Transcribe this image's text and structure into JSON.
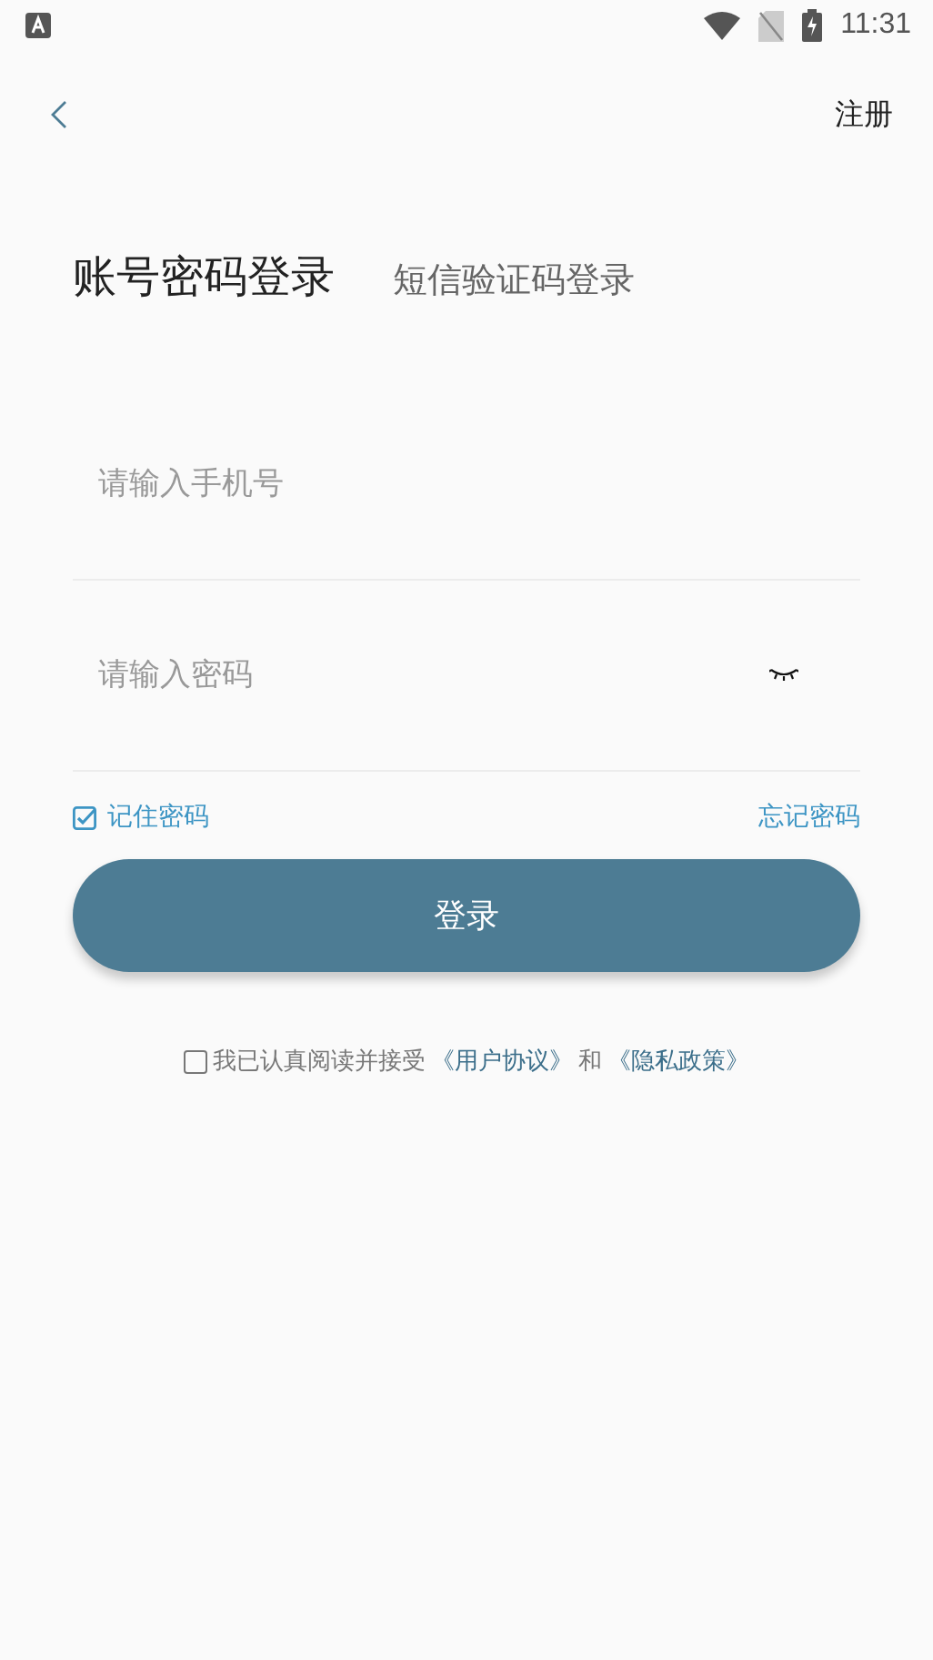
{
  "status_bar": {
    "time": "11:31"
  },
  "nav": {
    "action": "注册"
  },
  "tabs": [
    {
      "label": "账号密码登录",
      "selected": true
    },
    {
      "label": "短信验证码登录",
      "selected": false
    }
  ],
  "fields": [
    {
      "kind": "phone",
      "placeholder": "请输入手机号"
    },
    {
      "kind": "password",
      "placeholder": "请输入密码"
    }
  ],
  "remember": {
    "label": "记住密码",
    "checked": true
  },
  "forgot": "忘记密码",
  "login_button": "登录",
  "agreement": {
    "checked": false,
    "text": "我已认真阅读并接受",
    "link_1": "《用户协议》",
    "joiner": "和",
    "link_2": "《隐私政策》"
  }
}
